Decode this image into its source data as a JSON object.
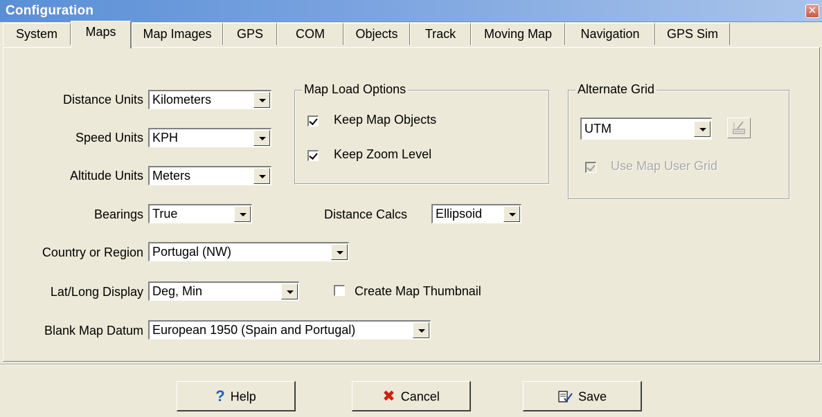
{
  "window": {
    "title": "Configuration"
  },
  "tabs": [
    {
      "label": "System"
    },
    {
      "label": "Maps"
    },
    {
      "label": "Map Images"
    },
    {
      "label": "GPS"
    },
    {
      "label": "COM"
    },
    {
      "label": "Objects"
    },
    {
      "label": "Track"
    },
    {
      "label": "Moving Map"
    },
    {
      "label": "Navigation"
    },
    {
      "label": "GPS Sim"
    }
  ],
  "active_tab": "Maps",
  "fields": {
    "distance_units": {
      "label": "Distance Units",
      "value": "Kilometers"
    },
    "speed_units": {
      "label": "Speed Units",
      "value": "KPH"
    },
    "altitude_units": {
      "label": "Altitude Units",
      "value": "Meters"
    },
    "bearings": {
      "label": "Bearings",
      "value": "True"
    },
    "distance_calcs": {
      "label": "Distance Calcs",
      "value": "Ellipsoid"
    },
    "country_region": {
      "label": "Country or Region",
      "value": "Portugal (NW)"
    },
    "latlong_display": {
      "label": "Lat/Long Display",
      "value": "Deg, Min"
    },
    "blank_map_datum": {
      "label": "Blank Map Datum",
      "value": "European 1950 (Spain and Portugal)"
    }
  },
  "map_load_options": {
    "legend": "Map Load Options",
    "keep_map_objects": {
      "label": "Keep Map Objects",
      "checked": true
    },
    "keep_zoom_level": {
      "label": "Keep Zoom Level",
      "checked": true
    }
  },
  "alternate_grid": {
    "legend": "Alternate Grid",
    "value": "UTM",
    "edit_icon": "grid-edit-icon",
    "use_map_user_grid": {
      "label": "Use Map User Grid",
      "checked": true,
      "disabled": true
    }
  },
  "create_map_thumbnail": {
    "label": "Create Map Thumbnail",
    "checked": false
  },
  "buttons": {
    "help": {
      "label": "Help",
      "icon": "question-icon",
      "color": "#1a5fc8"
    },
    "cancel": {
      "label": "Cancel",
      "icon": "x-icon",
      "color": "#d02010"
    },
    "save": {
      "label": "Save",
      "icon": "save-icon"
    }
  }
}
